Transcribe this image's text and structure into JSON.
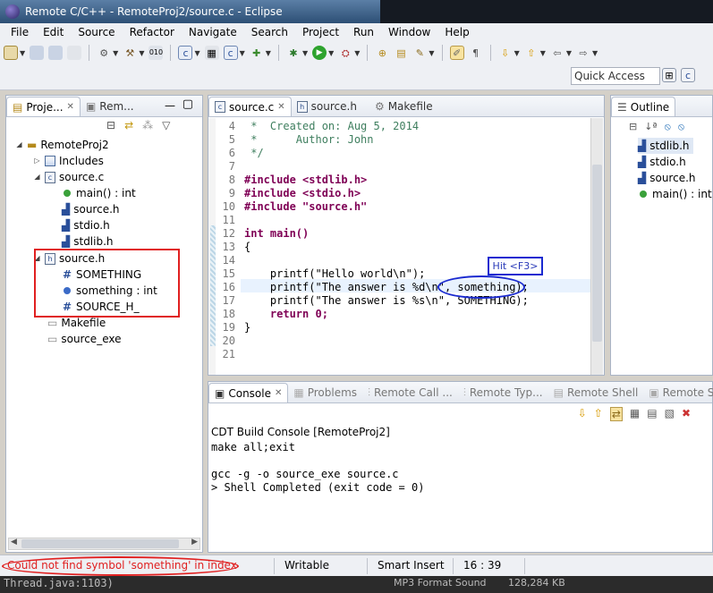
{
  "window": {
    "title": "Remote C/C++ - RemoteProj2/source.c - Eclipse"
  },
  "menu": [
    "File",
    "Edit",
    "Source",
    "Refactor",
    "Navigate",
    "Search",
    "Project",
    "Run",
    "Window",
    "Help"
  ],
  "toolbar": {
    "quick_access": "Quick Access"
  },
  "project_explorer": {
    "tabs": [
      {
        "label": "Proje..."
      },
      {
        "label": "Rem..."
      }
    ],
    "tree": [
      {
        "label": "RemoteProj2",
        "icon": "project-folder-icon",
        "depth": 0,
        "expanded": true
      },
      {
        "label": "Includes",
        "icon": "includes-icon",
        "depth": 1,
        "expanded": false
      },
      {
        "label": "source.c",
        "icon": "c-file-icon",
        "depth": 1,
        "expanded": true
      },
      {
        "label": "main() : int",
        "icon": "function-icon",
        "depth": 2
      },
      {
        "label": "source.h",
        "icon": "include-icon",
        "depth": 2
      },
      {
        "label": "stdio.h",
        "icon": "include-icon",
        "depth": 2
      },
      {
        "label": "stdlib.h",
        "icon": "include-icon",
        "depth": 2
      },
      {
        "label": "source.h",
        "icon": "h-file-icon",
        "depth": 1,
        "expanded": true
      },
      {
        "label": "SOMETHING",
        "icon": "macro-icon",
        "depth": 2
      },
      {
        "label": "something : int",
        "icon": "variable-icon",
        "depth": 2
      },
      {
        "label": "SOURCE_H_",
        "icon": "macro-icon",
        "depth": 2
      },
      {
        "label": "Makefile",
        "icon": "file-icon",
        "depth": 1
      },
      {
        "label": "source_exe",
        "icon": "file-icon",
        "depth": 1
      }
    ]
  },
  "editor": {
    "tabs": [
      {
        "label": "source.c",
        "active": true
      },
      {
        "label": "source.h",
        "active": false
      },
      {
        "label": "Makefile",
        "active": false
      }
    ],
    "lines": [
      {
        "n": "4",
        "text": " *  Created on: Aug 5, 2014"
      },
      {
        "n": "5",
        "text": " *      Author: John"
      },
      {
        "n": "6",
        "text": " */"
      },
      {
        "n": "7",
        "text": ""
      },
      {
        "n": "8",
        "text": "#include <stdlib.h>"
      },
      {
        "n": "9",
        "text": "#include <stdio.h>"
      },
      {
        "n": "10",
        "text": "#include \"source.h\""
      },
      {
        "n": "11",
        "text": ""
      },
      {
        "n": "12",
        "text": "int main()"
      },
      {
        "n": "13",
        "text": "{"
      },
      {
        "n": "14",
        "text": ""
      },
      {
        "n": "15",
        "text": "    printf(\"Hello world\\n\");"
      },
      {
        "n": "16",
        "text": "    printf(\"The answer is %d\\n\", something);"
      },
      {
        "n": "17",
        "text": "    printf(\"The answer is %s\\n\", SOMETHING);"
      },
      {
        "n": "18",
        "text": "    return 0;"
      },
      {
        "n": "19",
        "text": "}"
      },
      {
        "n": "20",
        "text": ""
      },
      {
        "n": "21",
        "text": ""
      }
    ],
    "annotation_hint": "Hit <F3>"
  },
  "outline": {
    "title": "Outline",
    "items": [
      {
        "label": "stdlib.h",
        "icon": "include-icon"
      },
      {
        "label": "stdio.h",
        "icon": "include-icon"
      },
      {
        "label": "source.h",
        "icon": "include-icon"
      },
      {
        "label": "main() : int",
        "icon": "function-icon"
      }
    ]
  },
  "console": {
    "tabs": [
      {
        "label": "Console",
        "active": true
      },
      {
        "label": "Problems"
      },
      {
        "label": "Remote Call ..."
      },
      {
        "label": "Remote Typ..."
      },
      {
        "label": "Remote Shell"
      },
      {
        "label": "Remote Sy"
      }
    ],
    "header": "CDT Build Console [RemoteProj2]",
    "lines": [
      "make all;exit",
      "",
      "gcc -g -o source_exe source.c",
      "> Shell Completed (exit code = 0)"
    ]
  },
  "status": {
    "message": "Could not find symbol 'something' in index",
    "writable": "Writable",
    "insert_mode": "Smart Insert",
    "position": "16 : 39"
  },
  "taskbar": {
    "left_text": "Thread.java:1103)",
    "right_text": "MP3 Format Sound",
    "right_size": "128,284 KB"
  },
  "colors": {
    "annotation_red": "#e02020",
    "annotation_blue": "#1a2ad0",
    "current_line": "#e8f2fe"
  }
}
